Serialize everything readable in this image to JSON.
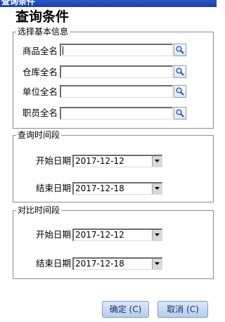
{
  "window": {
    "title": "查询条件"
  },
  "heading": "查询条件",
  "basic_info": {
    "legend": "选择基本信息",
    "fields": [
      {
        "label": "商品全名",
        "value": ""
      },
      {
        "label": "仓库全名",
        "value": ""
      },
      {
        "label": "单位全名",
        "value": ""
      },
      {
        "label": "职员全名",
        "value": ""
      }
    ]
  },
  "query_period": {
    "legend": "查询时间段",
    "start_label": "开始日期",
    "start_value": "2017-12-12",
    "end_label": "结束日期",
    "end_value": "2017-12-18"
  },
  "compare_period": {
    "legend": "对比时间段",
    "start_label": "开始日期",
    "start_value": "2017-12-12",
    "end_label": "结束日期",
    "end_value": "2017-12-18"
  },
  "buttons": {
    "ok": "确定 (C)",
    "cancel": "取消 (C)"
  },
  "icons": {
    "search": "search-icon",
    "dropdown": "chevron-down-icon"
  }
}
